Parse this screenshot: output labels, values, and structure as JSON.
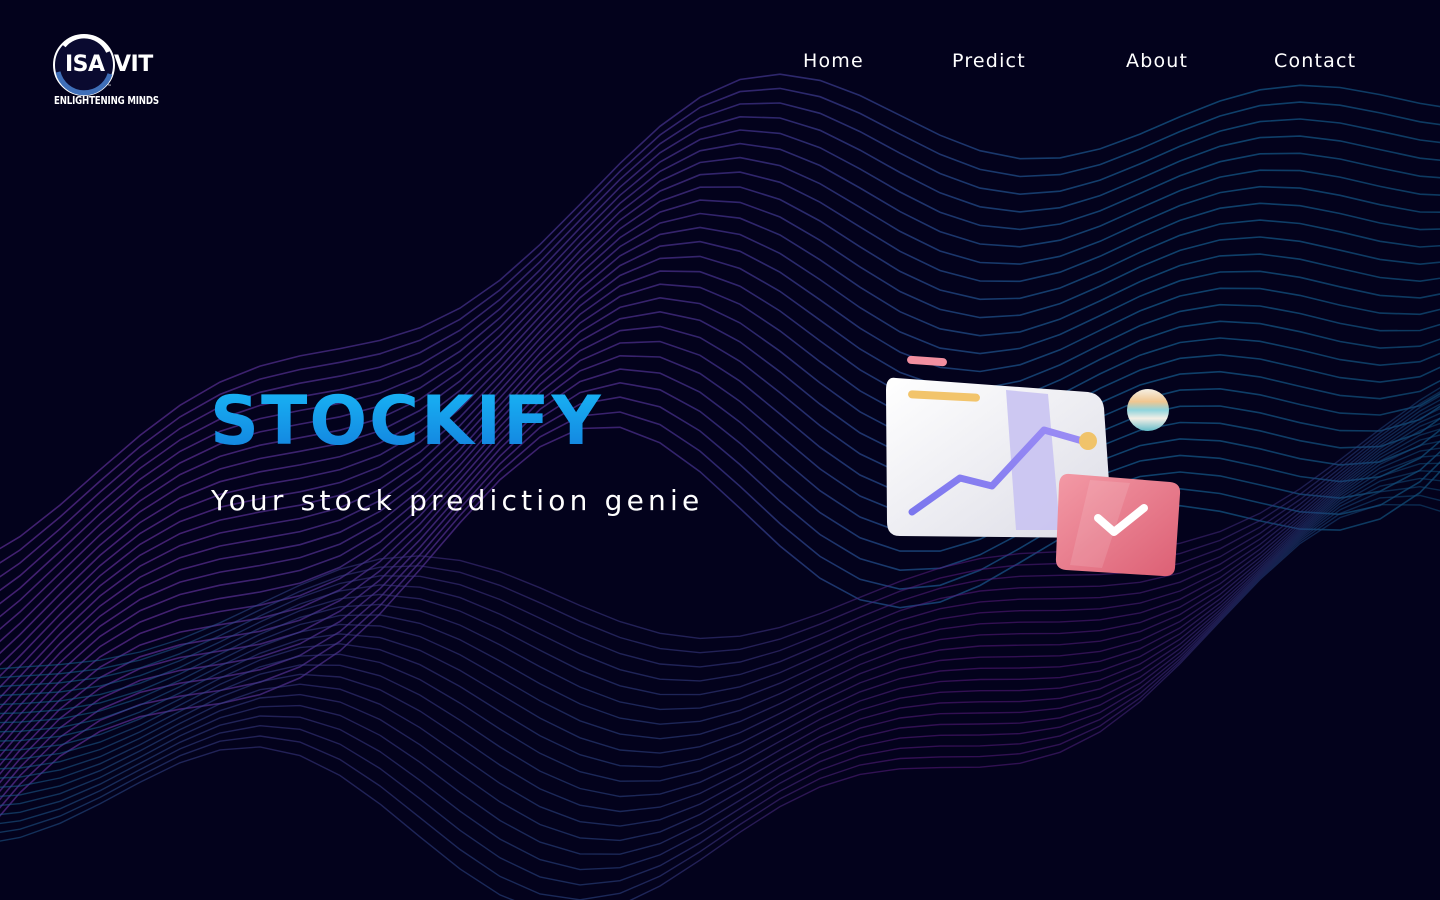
{
  "logo": {
    "abbr_left": "ISA",
    "abbr_right": "VIT",
    "tagline": "ENLIGHTENING MINDS",
    "trademark": "™",
    "ring_color": "#3f6fb8"
  },
  "nav": {
    "items": [
      {
        "label": "Home"
      },
      {
        "label": "Predict"
      },
      {
        "label": "About"
      },
      {
        "label": "Contact"
      }
    ]
  },
  "hero": {
    "title": "STOCKIFY",
    "subtitle": "Your stock prediction genie",
    "illustration_icon": "stock-chart-card-icon"
  },
  "colors": {
    "background": "#03021c",
    "title_gradient_top": "#18b4f5",
    "title_gradient_bottom": "#1380dd",
    "wave_purple": "#6a1a8a",
    "wave_teal": "#0f5a86"
  }
}
